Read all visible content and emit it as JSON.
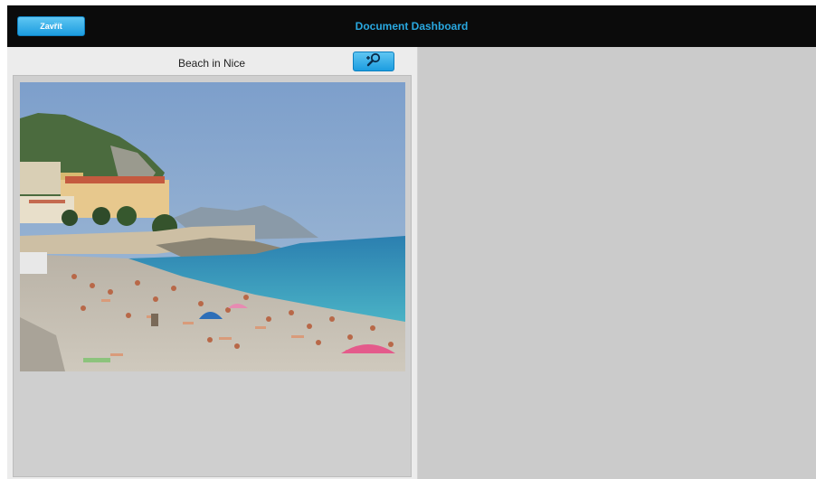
{
  "header": {
    "close_label": "Zavřít",
    "title": "Document Dashboard"
  },
  "document": {
    "title": "Beach in Nice",
    "zoom_icon": "zoom-icon",
    "image_icon": "beach-photo"
  },
  "colors": {
    "accent": "#29a8e0",
    "button": "#1c9de0",
    "topbar": "#0b0b0b",
    "panel": "#ececec",
    "workspace": "#cbcbcb"
  }
}
